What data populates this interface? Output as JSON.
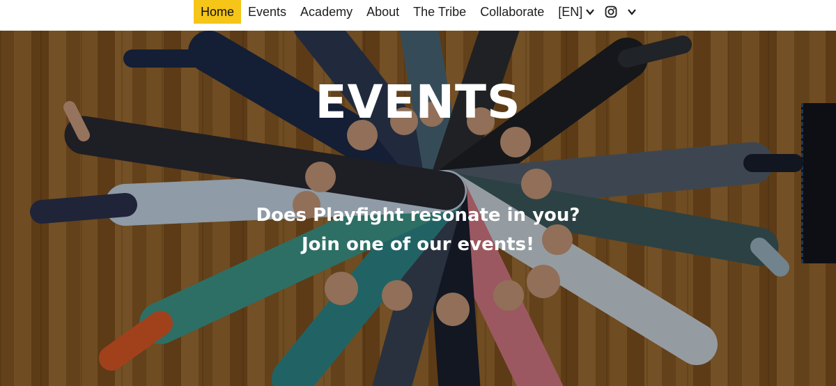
{
  "nav": {
    "items": [
      {
        "label": "Home",
        "active": true
      },
      {
        "label": "Events",
        "active": false
      },
      {
        "label": "Academy",
        "active": false
      },
      {
        "label": "About",
        "active": false
      },
      {
        "label": "The Tribe",
        "active": false
      },
      {
        "label": "Collaborate",
        "active": false
      }
    ],
    "language": "[EN]",
    "social_icon": "instagram-icon",
    "active_color": "#f5c518"
  },
  "hero": {
    "title": "EVENTS",
    "line1": "Does Playfight resonate in you?",
    "line2": "Join one of our events!"
  }
}
